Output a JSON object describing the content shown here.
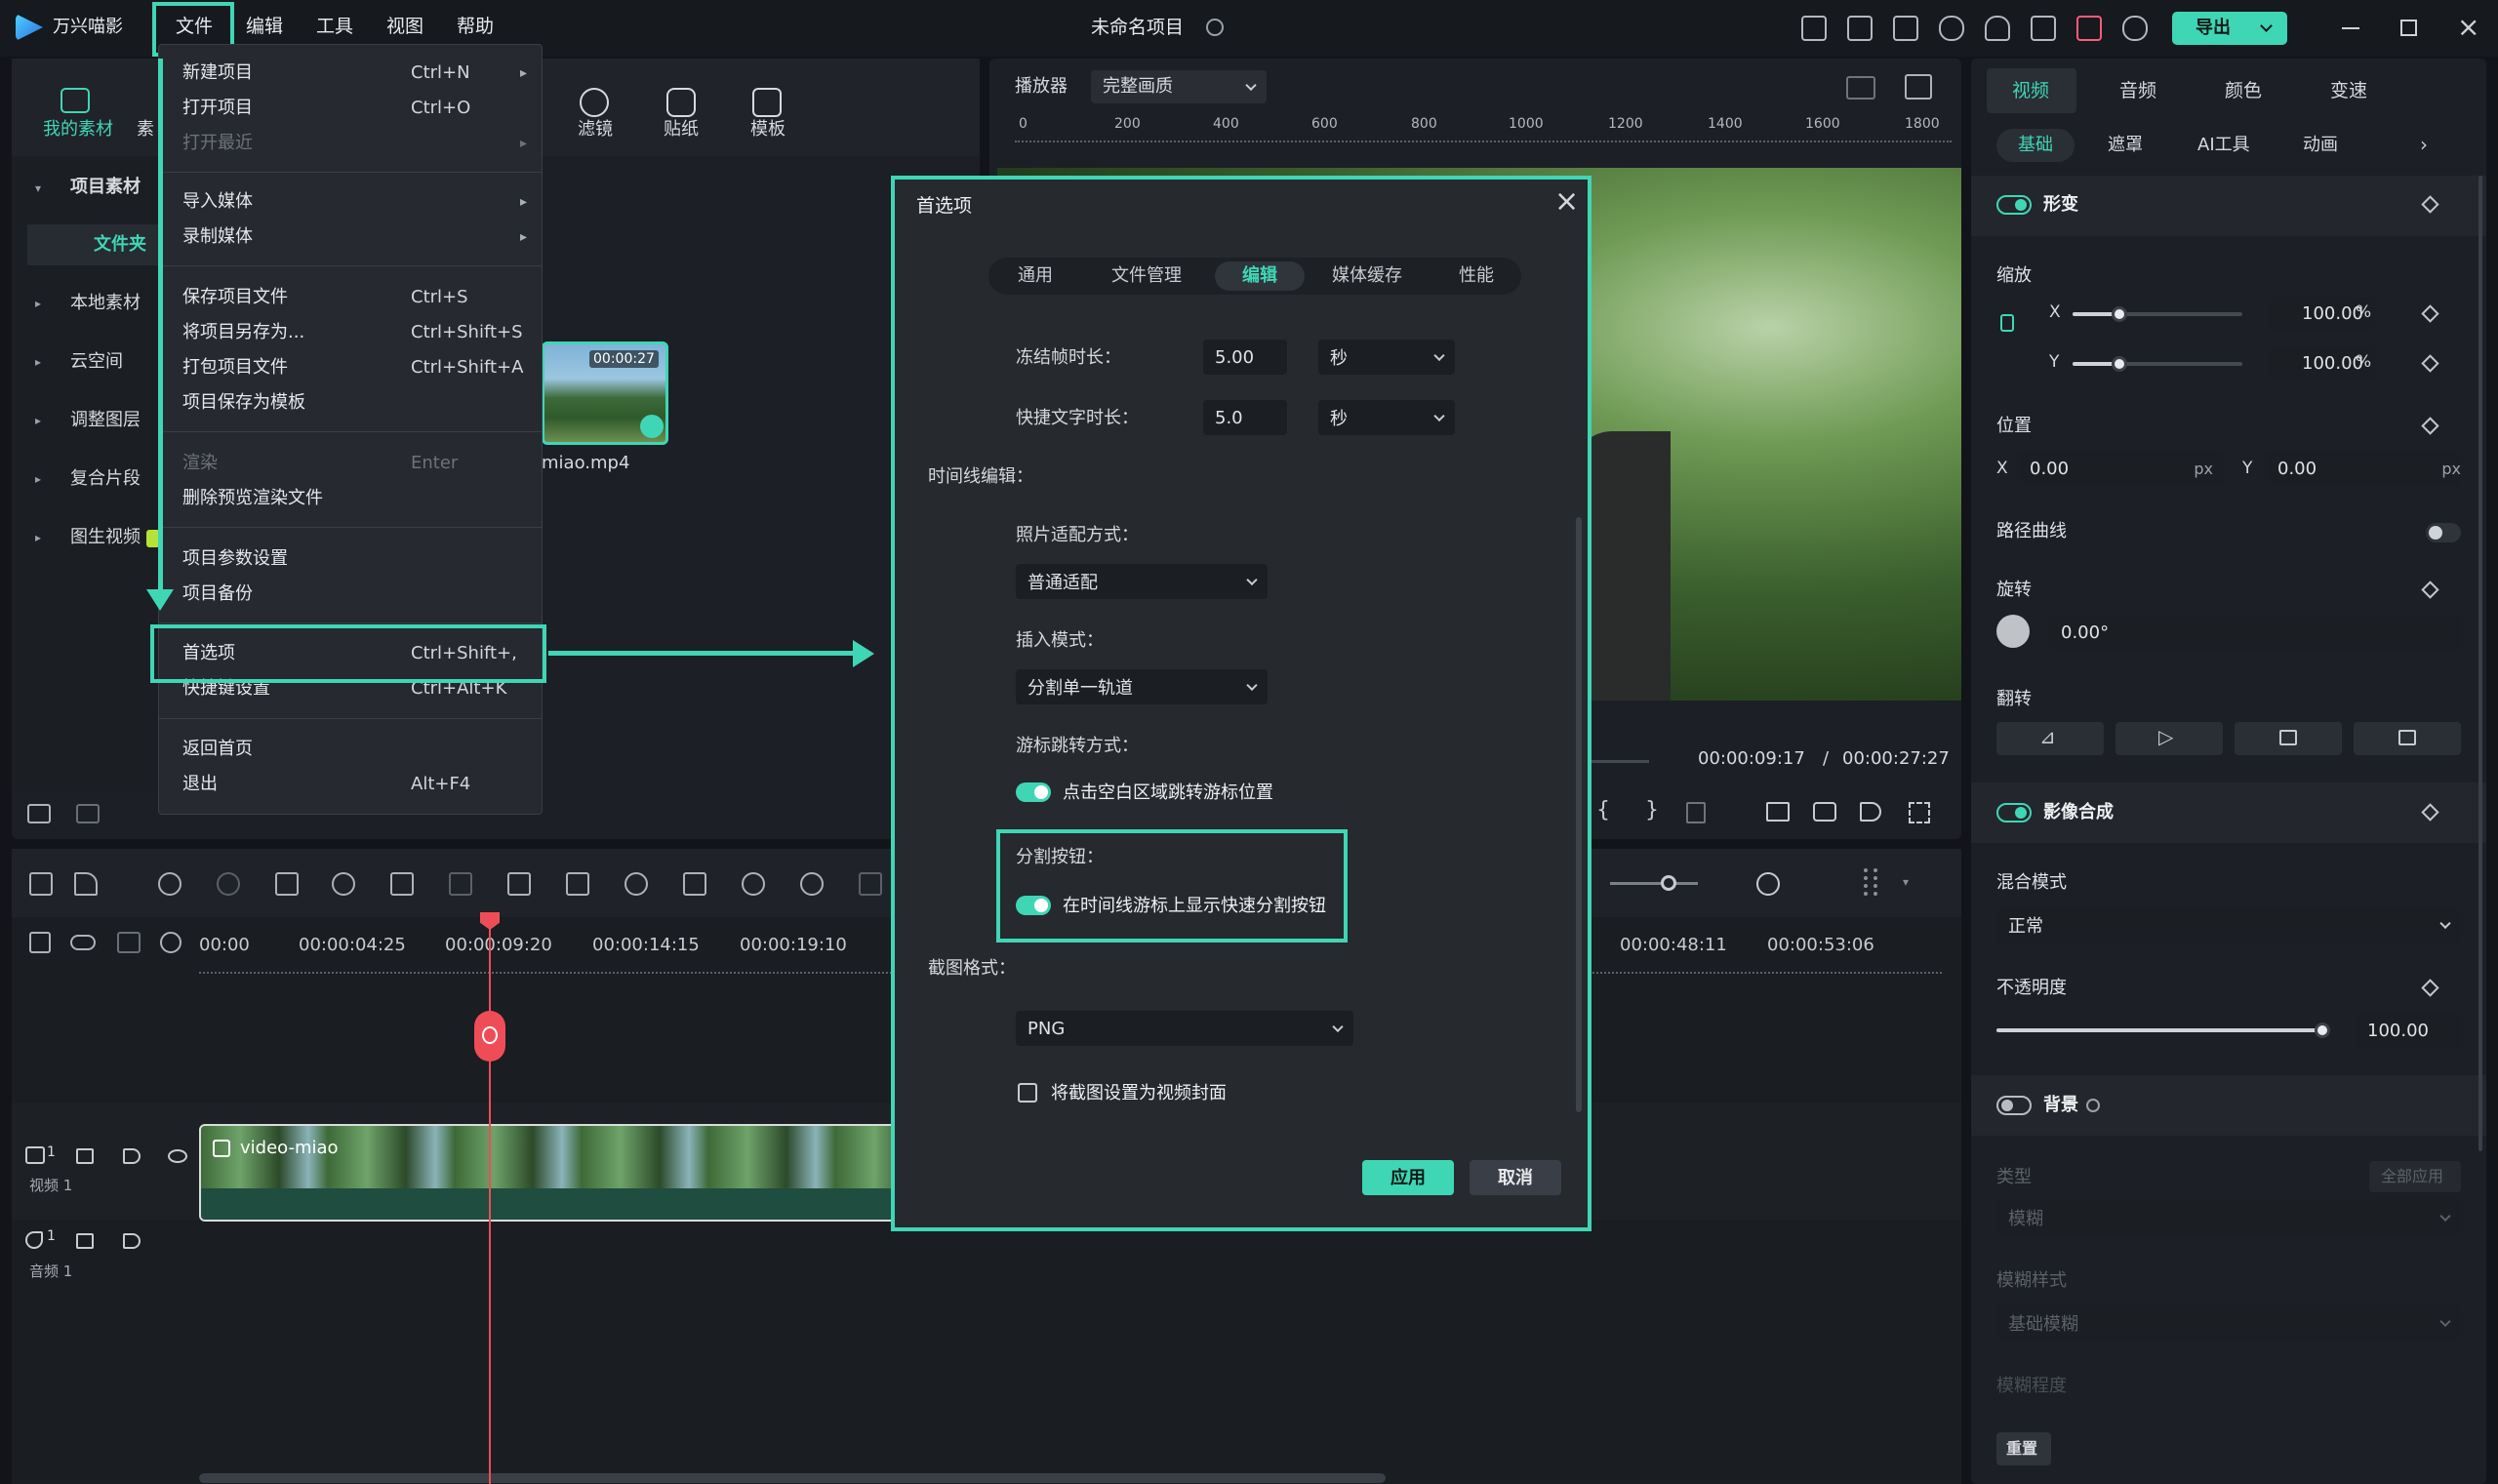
{
  "app": {
    "name": "万兴喵影",
    "project_title": "未命名项目",
    "export_label": "导出"
  },
  "menubar": [
    "文件",
    "编辑",
    "工具",
    "视图",
    "帮助"
  ],
  "media_toolbar": {
    "my_media": "我的素材",
    "stock": "素",
    "filters": "滤镜",
    "stickers": "贴纸",
    "templates": "模板"
  },
  "left_panel": {
    "project_media": "项目素材",
    "folder": "文件夹",
    "items": [
      "本地素材",
      "云空间",
      "调整图层",
      "复合片段",
      "图生视频"
    ]
  },
  "media_clip": {
    "duration": "00:00:27",
    "name": "miao.mp4"
  },
  "file_menu": {
    "items": [
      {
        "label": "新建项目",
        "shortcut": "Ctrl+N",
        "arrow": true
      },
      {
        "label": "打开项目",
        "shortcut": "Ctrl+O"
      },
      {
        "label": "打开最近",
        "arrow": true,
        "disabled": true
      },
      {
        "label": "导入媒体",
        "arrow": true
      },
      {
        "label": "录制媒体",
        "arrow": true
      },
      {
        "label": "保存项目文件",
        "shortcut": "Ctrl+S"
      },
      {
        "label": "将项目另存为...",
        "shortcut": "Ctrl+Shift+S"
      },
      {
        "label": "打包项目文件",
        "shortcut": "Ctrl+Shift+A"
      },
      {
        "label": "项目保存为模板"
      },
      {
        "label": "渲染",
        "shortcut": "Enter",
        "disabled": true
      },
      {
        "label": "删除预览渲染文件"
      },
      {
        "label": "项目参数设置"
      },
      {
        "label": "项目备份"
      },
      {
        "label": "首选项",
        "shortcut": "Ctrl+Shift+,"
      },
      {
        "label": "快捷键设置",
        "shortcut": "Ctrl+Alt+K"
      },
      {
        "label": "返回首页"
      },
      {
        "label": "退出",
        "shortcut": "Alt+F4"
      }
    ]
  },
  "player": {
    "label": "播放器",
    "quality": "完整画质",
    "current_time": "00:00:09:17",
    "separator": "/",
    "total_time": "00:00:27:27"
  },
  "player_ruler": [
    "0",
    "200",
    "400",
    "600",
    "800",
    "1000",
    "1200",
    "1400",
    "1600",
    "1800"
  ],
  "dialog": {
    "title": "首选项",
    "tabs": [
      "通用",
      "文件管理",
      "编辑",
      "媒体缓存",
      "性能"
    ],
    "active_tab": "编辑",
    "freeze_label": "冻结帧时长：",
    "freeze_value": "5.00",
    "freeze_unit": "秒",
    "quicktext_label": "快捷文字时长：",
    "quicktext_value": "5.0",
    "quicktext_unit": "秒",
    "timeline_section": "时间线编辑：",
    "photo_fit_label": "照片适配方式：",
    "photo_fit_value": "普通适配",
    "insert_mode_label": "插入模式：",
    "insert_mode_value": "分割单一轨道",
    "cursor_jump_label": "游标跳转方式：",
    "cursor_jump_option": "点击空白区域跳转游标位置",
    "split_label": "分割按钮：",
    "split_option": "在时间线游标上显示快速分割按钮",
    "screenshot_format_label": "截图格式：",
    "screenshot_format_value": "PNG",
    "cover_option": "将截图设置为视频封面",
    "apply": "应用",
    "cancel": "取消"
  },
  "right_panel": {
    "tabs": [
      "视频",
      "音频",
      "颜色",
      "变速"
    ],
    "subtabs": [
      "基础",
      "遮罩",
      "AI工具",
      "动画"
    ],
    "transform": "形变",
    "scale": "缩放",
    "scale_x_label": "X",
    "scale_x": "100.00",
    "scale_y_label": "Y",
    "scale_y": "100.00",
    "percent": "%",
    "scale_level": 0.1,
    "position": "位置",
    "pos_x_label": "X",
    "pos_x": "0.00",
    "pos_y_label": "Y",
    "pos_y": "0.00",
    "px": "px",
    "path_curve": "路径曲线",
    "rotation": "旋转",
    "rotation_value": "0.00°",
    "flip": "翻转",
    "compositing": "影像合成",
    "blend_mode": "混合模式",
    "blend_value": "正常",
    "opacity": "不透明度",
    "opacity_value": "100.00",
    "opacity_level": 1.0,
    "background": "背景",
    "bg_type": "类型",
    "apply_all": "全部应用",
    "bg_type_value": "模糊",
    "blur_style": "模糊样式",
    "blur_style_value": "基础模糊",
    "blur_amount": "模糊程度",
    "reset": "重置"
  },
  "timeline": {
    "ruler": [
      "00:00",
      "00:00:04:25",
      "00:00:09:20",
      "00:00:14:15",
      "00:00:19:10",
      "00:00:48:11",
      "00:00:53:06"
    ],
    "video_track_label": "视频 1",
    "audio_track_label": "音频 1",
    "video_track_num": "1",
    "audio_track_num": "1",
    "clip_name": "video-miao"
  },
  "colors": {
    "accent": "#3fd6b6",
    "playhead": "#ee4d57"
  }
}
